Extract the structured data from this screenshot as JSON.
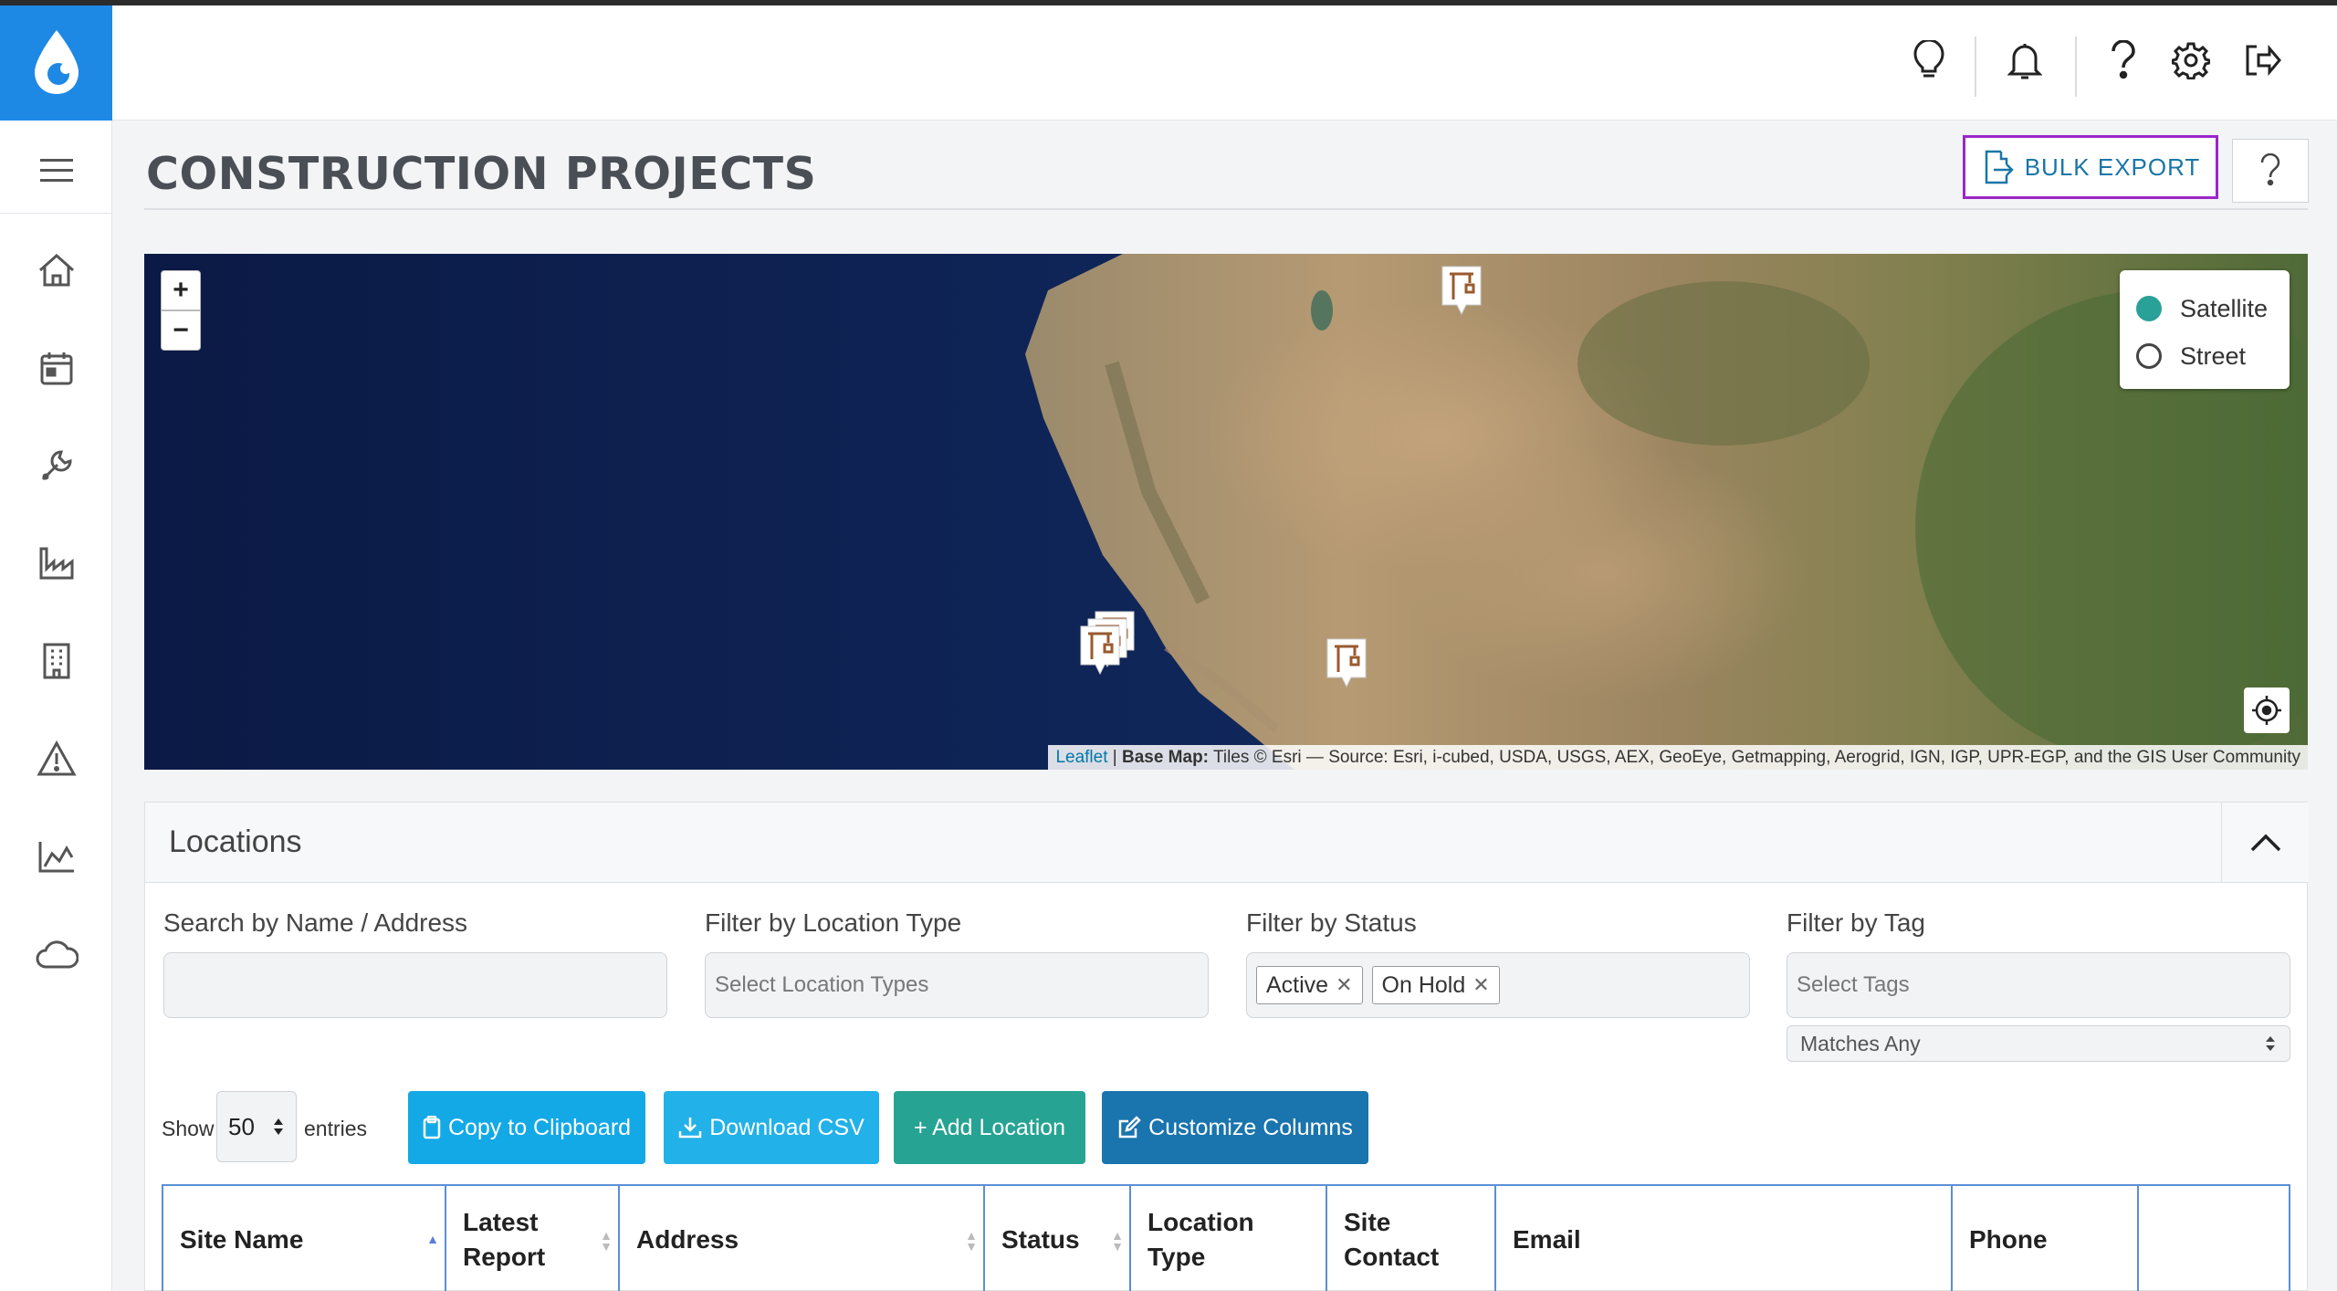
{
  "header": {
    "icons": [
      "lightbulb-icon",
      "bell-icon",
      "help-icon",
      "gear-icon",
      "logout-icon"
    ]
  },
  "sidebar": {
    "items": [
      "home-icon",
      "calendar-icon",
      "wrench-icon",
      "factory-icon",
      "building-icon",
      "warning-icon",
      "chart-icon",
      "cloud-icon"
    ]
  },
  "page": {
    "title": "CONSTRUCTION PROJECTS",
    "bulk_export_label": "BULK EXPORT"
  },
  "map": {
    "zoom_in": "+",
    "zoom_out": "−",
    "layers": [
      {
        "label": "Satellite",
        "selected": true
      },
      {
        "label": "Street",
        "selected": false
      }
    ],
    "attribution": {
      "leaflet": "Leaflet",
      "sep": " | ",
      "basemap_label": "Base Map:",
      "text": " Tiles © Esri — Source: Esri, i-cubed, USDA, USGS, AEX, GeoEye, Getmapping, Aerogrid, IGN, IGP, UPR-EGP, and the GIS User Community"
    }
  },
  "locations": {
    "title": "Locations",
    "filters": {
      "search_label": "Search by Name / Address",
      "search_value": "",
      "type_label": "Filter by Location Type",
      "type_placeholder": "Select Location Types",
      "status_label": "Filter by Status",
      "status_chips": [
        "Active",
        "On Hold"
      ],
      "tag_label": "Filter by Tag",
      "tag_placeholder": "Select Tags",
      "tag_match": "Matches Any"
    },
    "show_label": "Show",
    "entries_value": "50",
    "entries_label": "entries",
    "buttons": {
      "copy": "Copy to Clipboard",
      "download": "Download CSV",
      "add": "+ Add Location",
      "customize": "Customize Columns"
    },
    "columns": [
      "Site Name",
      "Latest Report",
      "Address",
      "Status",
      "Location Type",
      "Site Contact",
      "Email",
      "Phone",
      ""
    ]
  },
  "colors": {
    "logo_bg": "#1e88e5",
    "copy_btn": "#13a9e6",
    "download_btn": "#22b1e8",
    "add_btn": "#27a393",
    "customize_btn": "#1a74ad",
    "bulk_export_border": "#9b27c8"
  }
}
